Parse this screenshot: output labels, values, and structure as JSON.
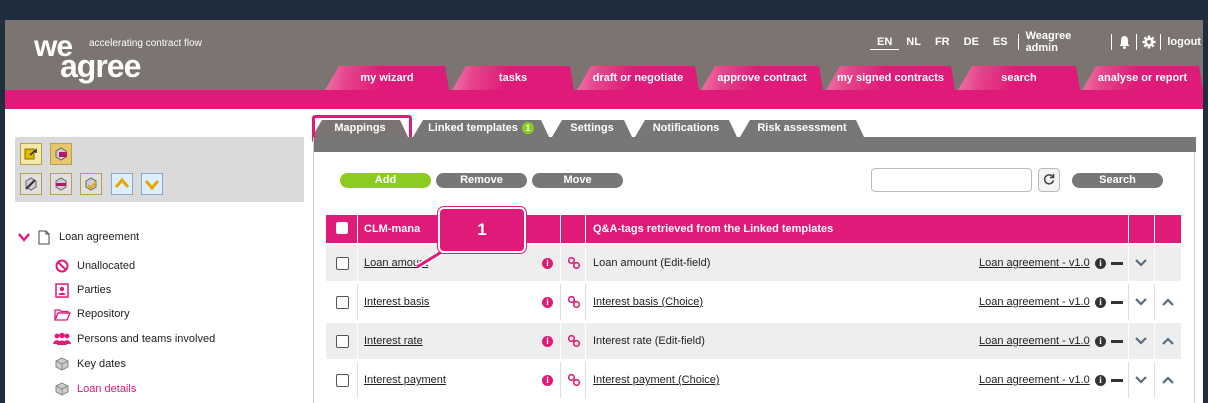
{
  "logo": {
    "word1": "we",
    "word2": "agree",
    "tagline": "accelerating contract flow"
  },
  "topbar": {
    "languages": [
      "EN",
      "NL",
      "FR",
      "DE",
      "ES"
    ],
    "active_language": "EN",
    "user": "Weagree admin",
    "logout": "logout",
    "icons": [
      "bell-icon",
      "gear-icon"
    ]
  },
  "mainnav": [
    {
      "label": "my wizard"
    },
    {
      "label": "tasks"
    },
    {
      "label": "draft or negotiate"
    },
    {
      "label": "approve contract"
    },
    {
      "label": "my signed contracts"
    },
    {
      "label": "search"
    },
    {
      "label": "analyse or report"
    }
  ],
  "subtabs": [
    {
      "label": "Mappings"
    },
    {
      "label": "Linked templates",
      "badge": "1"
    },
    {
      "label": "Settings"
    },
    {
      "label": "Notifications"
    },
    {
      "label": "Risk assessment"
    }
  ],
  "actions": {
    "add": "Add",
    "remove": "Remove",
    "move": "Move",
    "search": "Search",
    "search_value": ""
  },
  "tree": {
    "root": "Loan agreement",
    "items": [
      {
        "label": "Unallocated",
        "icon": "no-entry-icon"
      },
      {
        "label": "Parties",
        "icon": "person-card-icon"
      },
      {
        "label": "Repository",
        "icon": "folder-icon"
      },
      {
        "label": "Persons and teams involved",
        "icon": "people-icon"
      },
      {
        "label": "Key dates",
        "icon": "cubes-icon"
      },
      {
        "label": "Loan details",
        "icon": "cubes-icon",
        "active": true
      }
    ]
  },
  "table": {
    "headers": {
      "clm": "CLM-mana",
      "qa": "Q&A-tags retrieved from the Linked templates"
    },
    "rows": [
      {
        "clm": "Loan amount",
        "qa": "Loan amount (Edit-field)",
        "qa_link": false,
        "template": "Loan agreement - v1.0",
        "up": false
      },
      {
        "clm": "Interest basis",
        "qa": "Interest basis (Choice)",
        "qa_link": true,
        "template": "Loan agreement - v1.0",
        "up": true
      },
      {
        "clm": "Interest rate",
        "qa": "Interest rate (Edit-field)",
        "qa_link": false,
        "template": "Loan agreement - v1.0",
        "up": true
      },
      {
        "clm": "Interest payment",
        "qa": "Interest payment (Choice)",
        "qa_link": true,
        "template": "Loan agreement - v1.0",
        "up": true
      }
    ]
  },
  "callout": {
    "number": "1"
  },
  "colors": {
    "brand_pink": "#e01a78",
    "header_gray": "#7b7470",
    "add_green": "#8ccc21"
  }
}
